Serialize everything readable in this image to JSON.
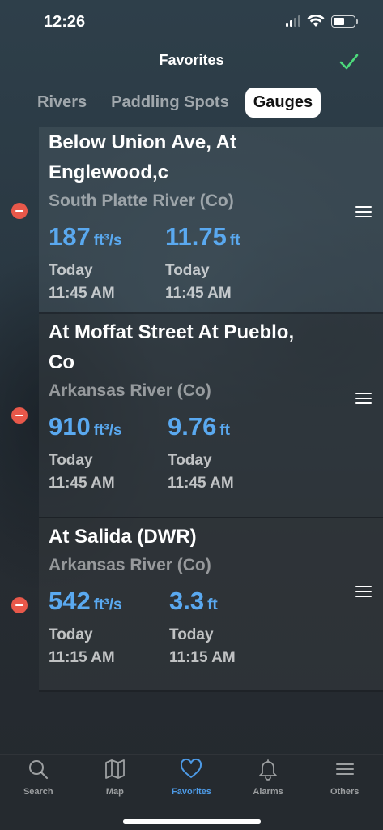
{
  "status": {
    "time": "12:26"
  },
  "header": {
    "title": "Favorites"
  },
  "tabs": [
    {
      "label": "Rivers"
    },
    {
      "label": "Paddling Spots"
    },
    {
      "label": "Gauges"
    }
  ],
  "gauges": [
    {
      "name_line1": "Below Union Ave, At",
      "name_line2": "Englewood,c",
      "river": "South Platte River (Co)",
      "flow_value": "187",
      "flow_unit": "ft³/s",
      "flow_day": "Today",
      "flow_time": "11:45 AM",
      "height_value": "11.75",
      "height_unit": "ft",
      "height_day": "Today",
      "height_time": "11:45 AM"
    },
    {
      "name_line1": "At Moffat Street At Pueblo,",
      "name_line2": "Co",
      "river": "Arkansas River (Co)",
      "flow_value": "910",
      "flow_unit": "ft³/s",
      "flow_day": "Today",
      "flow_time": "11:45 AM",
      "height_value": "9.76",
      "height_unit": "ft",
      "height_day": "Today",
      "height_time": "11:45 AM"
    },
    {
      "name_line1": "At Salida (DWR)",
      "river": "Arkansas River (Co)",
      "flow_value": "542",
      "flow_unit": "ft³/s",
      "flow_day": "Today",
      "flow_time": "11:15 AM",
      "height_value": "3.3",
      "height_unit": "ft",
      "height_day": "Today",
      "height_time": "11:15 AM"
    }
  ],
  "tabbar": [
    {
      "label": "Search",
      "icon": "search-icon"
    },
    {
      "label": "Map",
      "icon": "map-icon"
    },
    {
      "label": "Favorites",
      "icon": "heart-icon",
      "active": true
    },
    {
      "label": "Alarms",
      "icon": "bell-icon"
    },
    {
      "label": "Others",
      "icon": "menu-icon"
    }
  ],
  "colors": {
    "accent": "#5aa9f0",
    "active_tab": "#4d9ae6",
    "delete": "#e8584a",
    "check": "#4cd97b"
  }
}
